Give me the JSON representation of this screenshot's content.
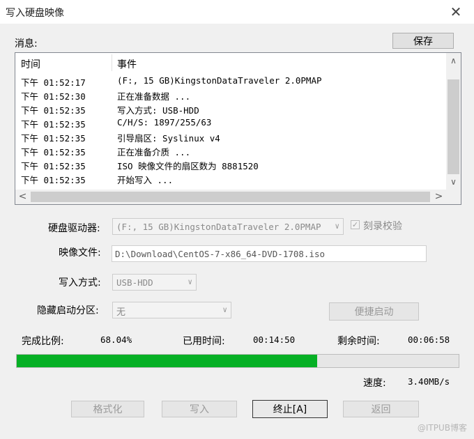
{
  "window": {
    "title": "写入硬盘映像",
    "close_glyph": "✕"
  },
  "messages": {
    "label": "消息:",
    "save_label": "保存",
    "columns": {
      "time": "时间",
      "event": "事件"
    },
    "rows": [
      {
        "time": "下午 01:52:17",
        "event": "(F:, 15 GB)KingstonDataTraveler 2.0PMAP"
      },
      {
        "time": "下午 01:52:30",
        "event": "正在准备数据 ..."
      },
      {
        "time": "下午 01:52:35",
        "event": "写入方式: USB-HDD"
      },
      {
        "time": "下午 01:52:35",
        "event": "C/H/S: 1897/255/63"
      },
      {
        "time": "下午 01:52:35",
        "event": "引导扇区: Syslinux v4"
      },
      {
        "time": "下午 01:52:35",
        "event": "正在准备介质 ..."
      },
      {
        "time": "下午 01:52:35",
        "event": "ISO 映像文件的扇区数为 8881520"
      },
      {
        "time": "下午 01:52:35",
        "event": "开始写入 ..."
      }
    ]
  },
  "form": {
    "drive_label": "硬盘驱动器:",
    "drive_value": "(F:, 15 GB)KingstonDataTraveler 2.0PMAP",
    "verify_label": "刻录校验",
    "verify_checked": true,
    "image_label": "映像文件:",
    "image_value": "D:\\Download\\CentOS-7-x86_64-DVD-1708.iso",
    "write_mode_label": "写入方式:",
    "write_mode_value": "USB-HDD",
    "hidden_part_label": "隐藏启动分区:",
    "hidden_part_value": "无",
    "quick_boot_label": "便捷启动"
  },
  "status": {
    "percent_label": "完成比例:",
    "percent_value": "68.04%",
    "progress": 0.6804,
    "elapsed_label": "已用时间:",
    "elapsed_value": "00:14:50",
    "remaining_label": "剩余时间:",
    "remaining_value": "00:06:58",
    "speed_label": "速度:",
    "speed_value": "3.40MB/s",
    "progress_color": "#06b025"
  },
  "buttons": {
    "format": "格式化",
    "write": "写入",
    "stop": "终止[A]",
    "back": "返回"
  },
  "watermark": "@ITPUB博客"
}
